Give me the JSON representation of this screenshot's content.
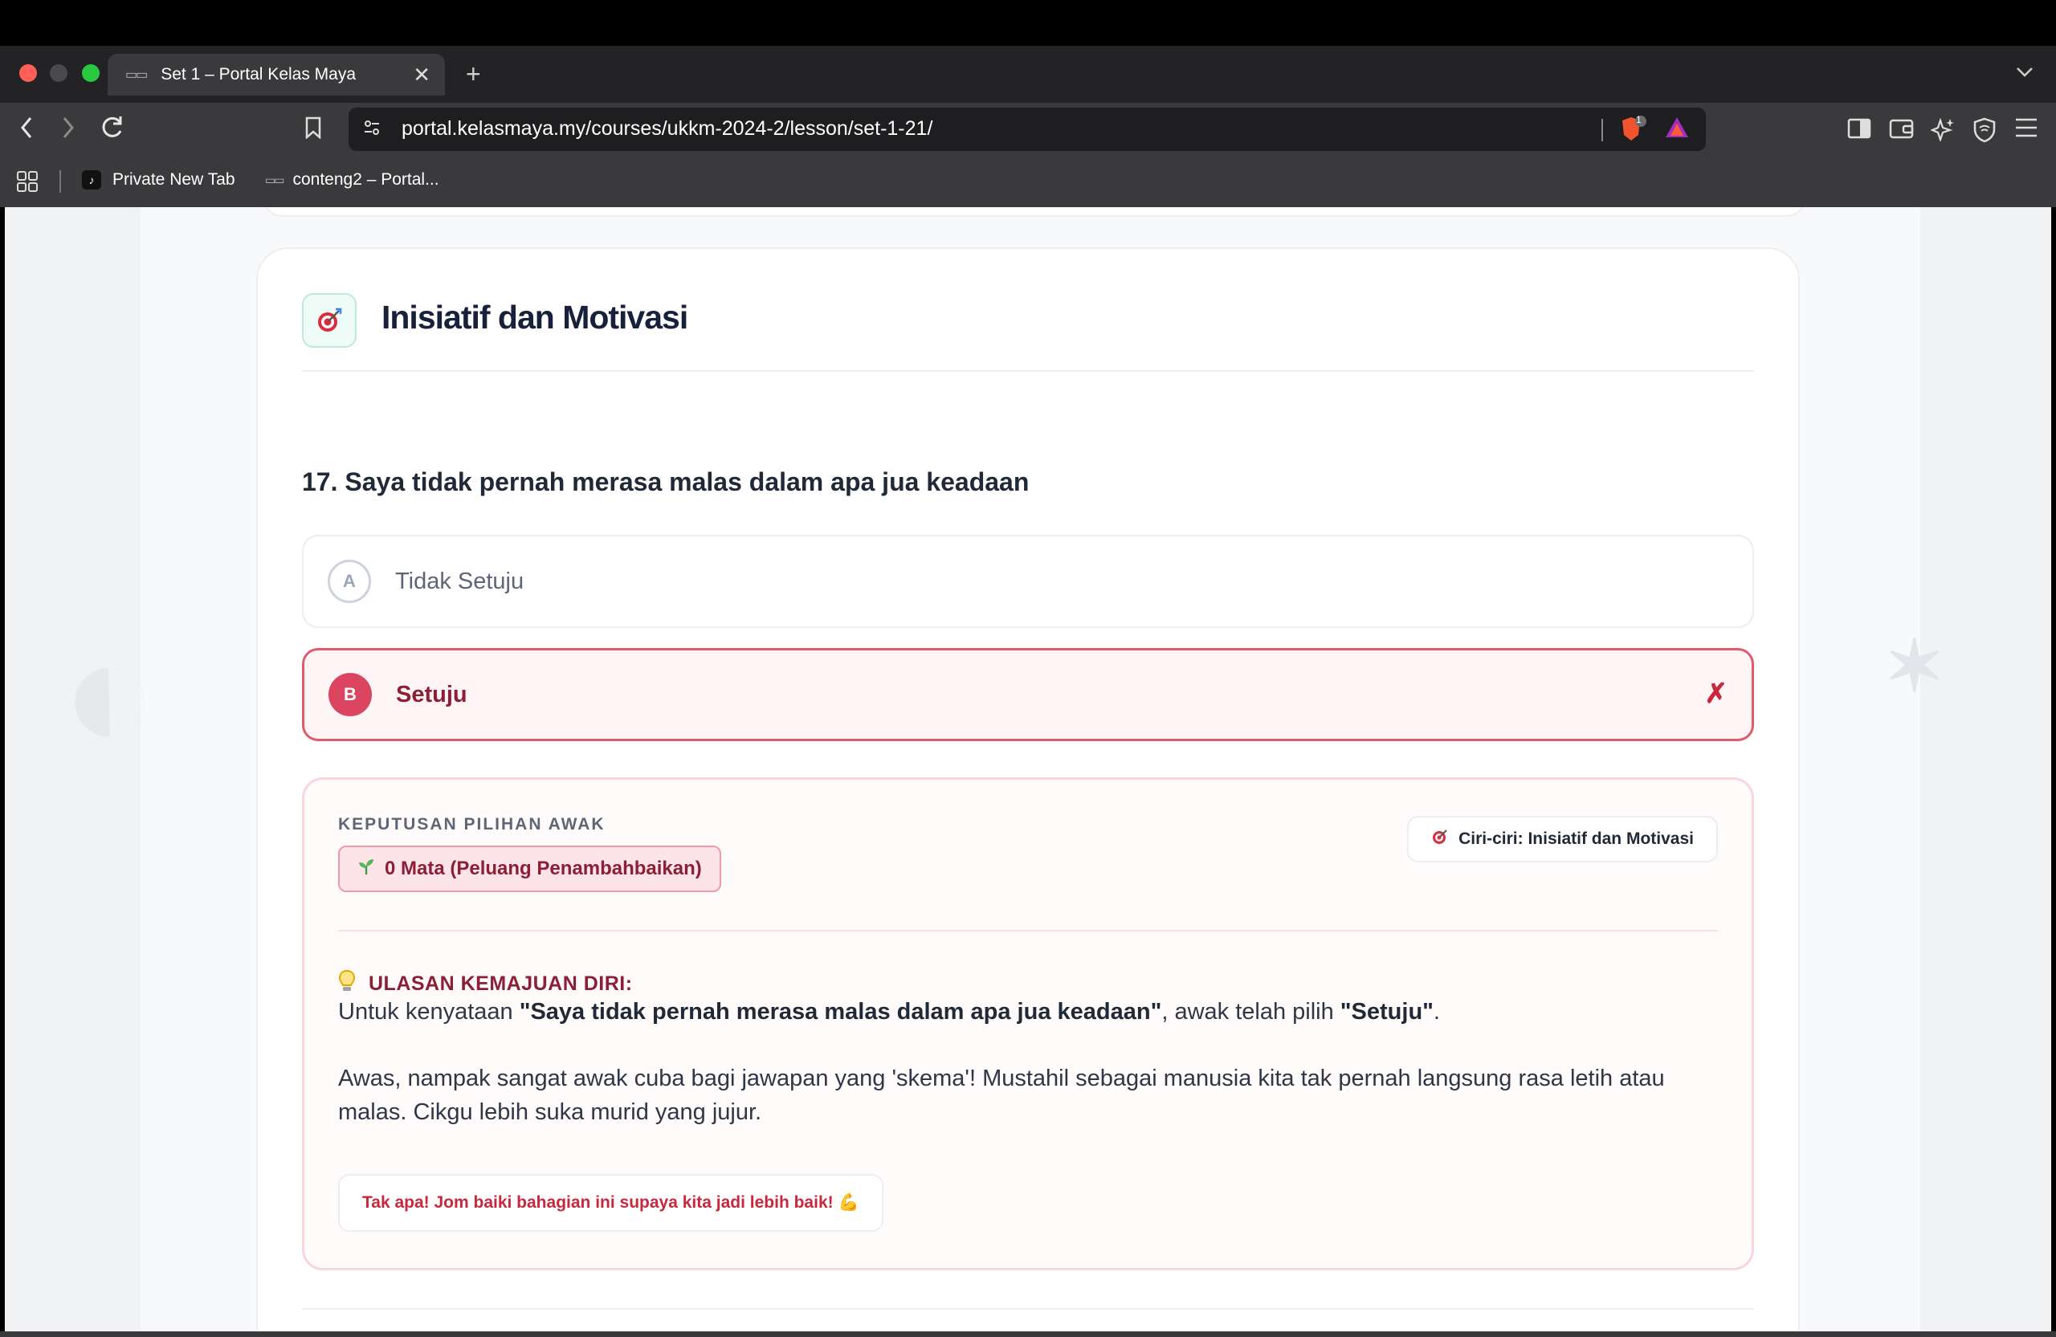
{
  "browser": {
    "tab_title": "Set 1 – Portal Kelas Maya",
    "tab_close": "✕",
    "new_tab": "+",
    "tab_menu": "⌄",
    "url": "portal.kelasmaya.my/courses/ukkm-2024-2/lesson/set-1-21/",
    "shield_count": "1",
    "bookmarks": [
      {
        "label": "Private New Tab",
        "icon": "tiktok-icon"
      },
      {
        "label": "conteng2 – Portal...",
        "icon": "site-icon"
      }
    ]
  },
  "section": {
    "title": "Inisiatif dan Motivasi",
    "icon": "target-icon"
  },
  "question": {
    "text": "17. Saya tidak pernah merasa malas dalam apa jua keadaan",
    "options": [
      {
        "letter": "A",
        "label": "Tidak Setuju",
        "state": "unselected"
      },
      {
        "letter": "B",
        "label": "Setuju",
        "state": "selected-wrong",
        "mark": "✗"
      }
    ]
  },
  "feedback": {
    "label": "KEPUTUSAN PILIHAN AWAK",
    "score": "0 Mata (Peluang Penambahbaikan)",
    "trait": "Ciri-ciri: Inisiatif dan Motivasi",
    "review_title": "ULASAN KEMAJUAN DIRI:",
    "line1_prefix": "Untuk kenyataan ",
    "line1_statement": "\"Saya tidak pernah merasa malas dalam apa jua keadaan\"",
    "line1_mid": ", awak telah pilih ",
    "line1_choice": "\"Setuju\"",
    "line1_suffix": ".",
    "line2": "Awas, nampak sangat awak cuba bagi jawapan yang 'skema'! Mustahil sebagai manusia kita tak pernah langsung rasa letih atau malas. Cikgu lebih suka murid yang jujur.",
    "encourage": "Tak apa! Jom baiki bahagian ini supaya kita jadi lebih baik! 💪"
  },
  "colors": {
    "accent_error": "#dc4560",
    "error_text": "#8b1f35",
    "traffic_red": "#ff5f57",
    "traffic_green": "#28c840"
  }
}
